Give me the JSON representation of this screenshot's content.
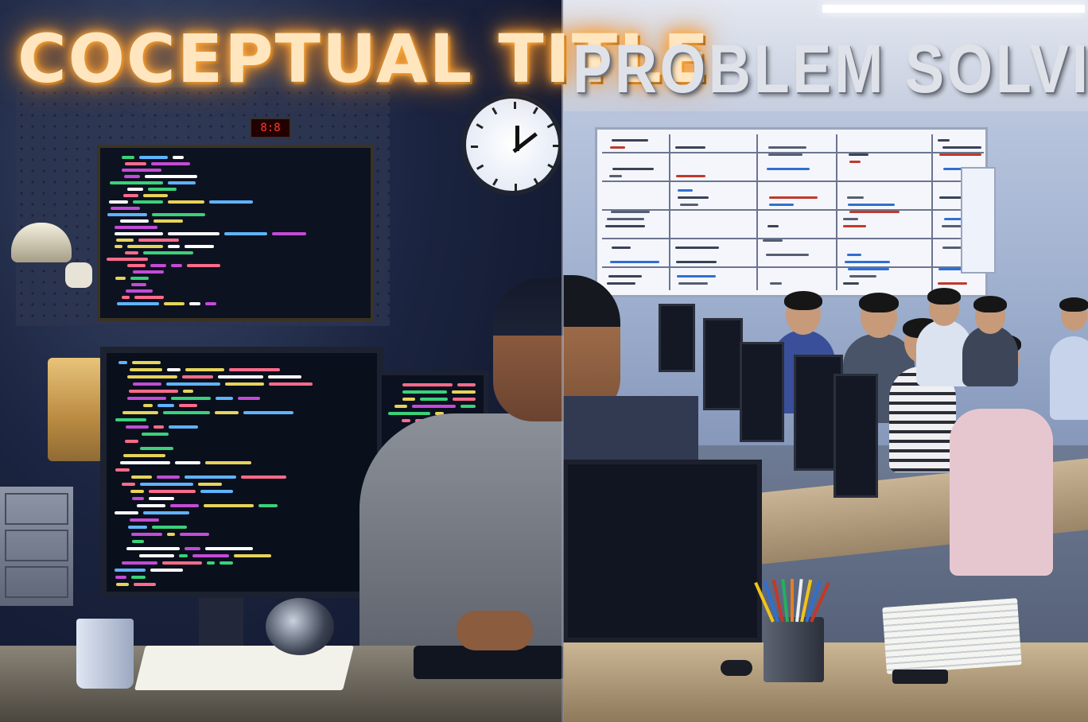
{
  "image": {
    "left_title": "COCEPTUAL TITLE",
    "right_title": "PROBLEM SOLVING",
    "left_scene": {
      "led_display": "8:8"
    },
    "colors": {
      "left_title_glow": "#ff9a2e",
      "left_title_text": "#ffe6bf",
      "right_title_text": "#dfe2e8",
      "left_background": "#1b2440",
      "right_background": "#9fb0cf",
      "code_colors": [
        "#c34bd6",
        "#3ad17a",
        "#e6d35a",
        "#5fb3ff",
        "#ff6b8a",
        "#ffffff"
      ]
    },
    "icons": [
      "wall-clock-icon",
      "desk-lamp-icon",
      "coffee-mug-icon",
      "speaker-icon",
      "pencil-cup-icon"
    ]
  }
}
